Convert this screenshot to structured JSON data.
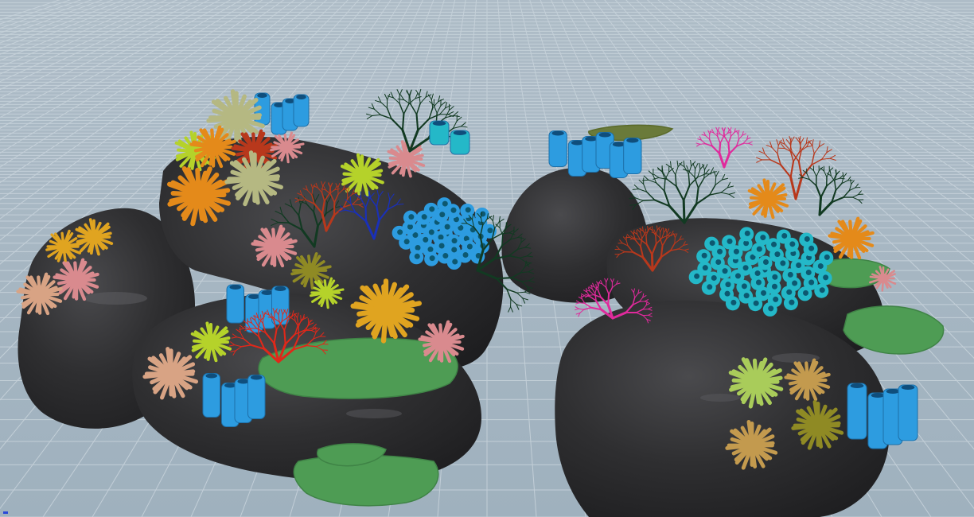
{
  "colors": {
    "sky": "#a9b8c4",
    "floor": "#a6b6c2",
    "grid_line": "#c7d3dc",
    "rock": "#2c2c2e",
    "rock_highlight": "#5a5a5e",
    "green_plate": "#4f9a55",
    "blue_tube": "#2d9ce0",
    "cyan_tube": "#24b8c8",
    "orange": "#e48a1a",
    "gold": "#e0a420",
    "yellow_green": "#b5d22a",
    "pink": "#d98a8e",
    "salmon": "#d8a384",
    "sage": "#b5b882",
    "red_branch": "#e0281a",
    "dark_branch": "#123a22",
    "magenta": "#e02a9c",
    "rust": "#b8381c",
    "navy_branch": "#1a30b8",
    "olive": "#8f8a24",
    "tan": "#c39a4e",
    "lime": "#a9cc5a"
  },
  "scene": {
    "description_visible": false,
    "axis_marker": "viewport-axis-indicator"
  }
}
